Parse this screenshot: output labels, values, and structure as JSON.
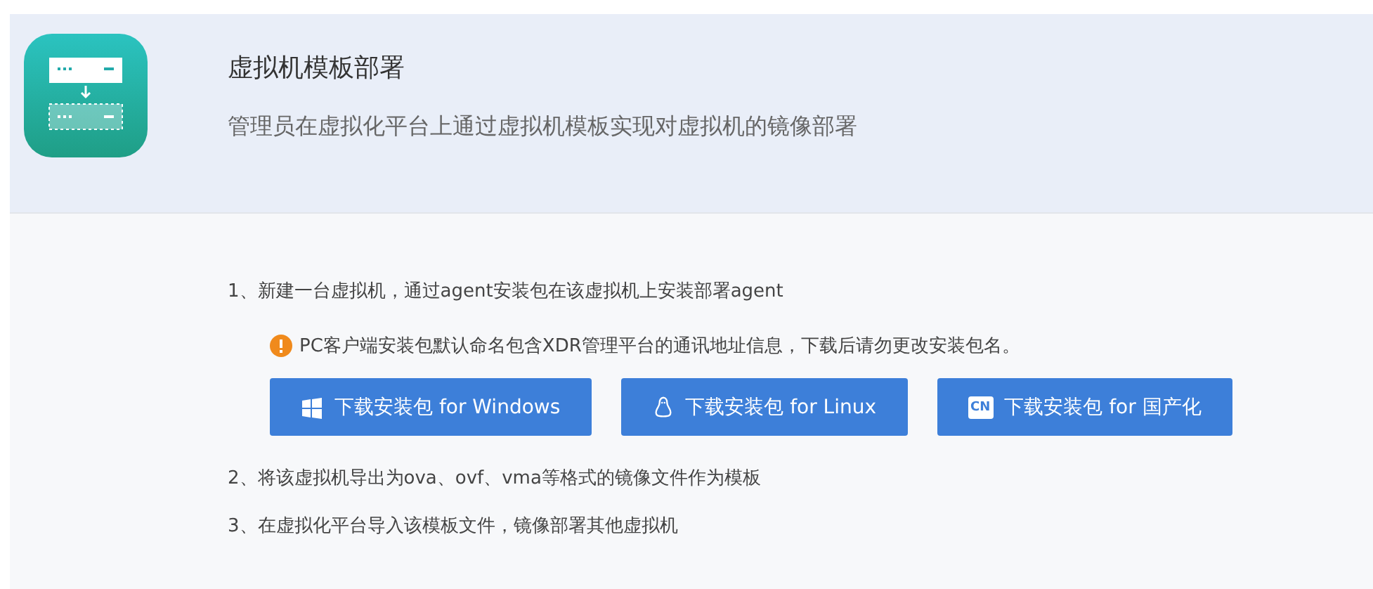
{
  "header": {
    "title": "虚拟机模板部署",
    "subtitle": "管理员在虚拟化平台上通过虚拟机模板实现对虚拟机的镜像部署"
  },
  "steps": [
    {
      "text": "1、新建一台虚拟机，通过agent安装包在该虚拟机上安装部署agent"
    },
    {
      "text": "2、将该虚拟机导出为ova、ovf、vma等格式的镜像文件作为模板"
    },
    {
      "text": "3、在虚拟化平台导入该模板文件，镜像部署其他虚拟机"
    }
  ],
  "notice": "PC客户端安装包默认命名包含XDR管理平台的通讯地址信息，下载后请勿更改安装包名。",
  "buttons": [
    {
      "kind": "windows",
      "label": "下载安装包 for Windows"
    },
    {
      "kind": "linux",
      "label": "下载安装包 for Linux"
    },
    {
      "kind": "cn",
      "badge": "CN",
      "label": "下载安装包 for 国产化"
    }
  ]
}
